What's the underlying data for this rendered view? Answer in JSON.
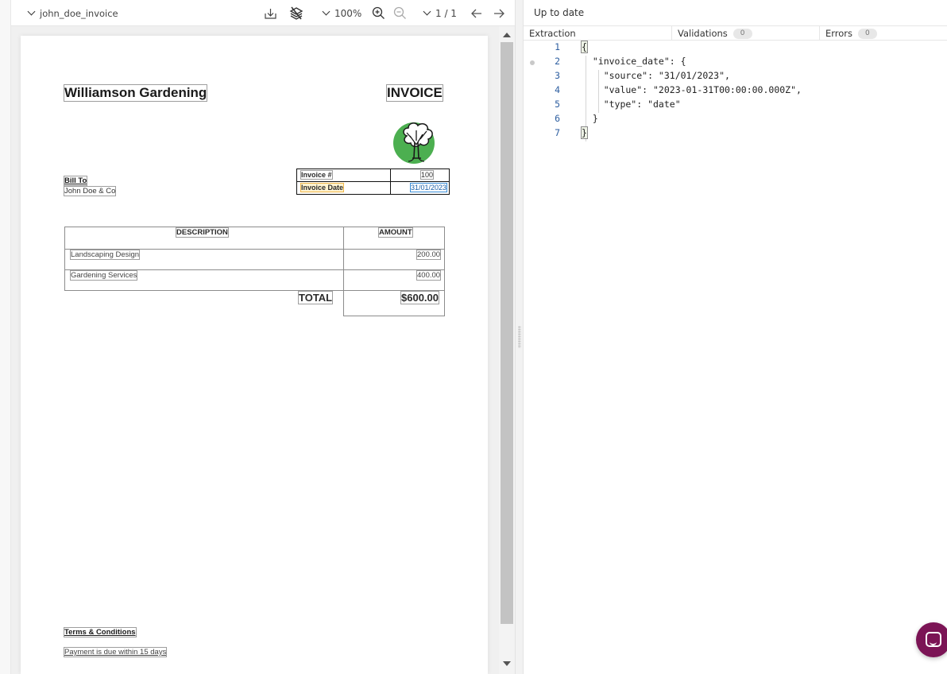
{
  "toolbar": {
    "document_name": "john_doe_invoice",
    "zoom": "100%",
    "page_indicator": "1 / 1",
    "icons": [
      "download-icon",
      "layers-off-icon",
      "zoom-in-icon",
      "zoom-out-icon",
      "arrow-left-icon",
      "arrow-right-icon"
    ]
  },
  "document": {
    "company": "Williamson Gardening",
    "heading": "INVOICE",
    "logo": "tree-logo",
    "bill_to_label": "Bill To",
    "bill_to_value": "John Doe & Co",
    "meta": [
      {
        "label": "Invoice #",
        "value": "100"
      },
      {
        "label": "Invoice Date",
        "value": "31/01/2023"
      }
    ],
    "items_headers": {
      "description": "DESCRIPTION",
      "amount": "AMOUNT"
    },
    "items": [
      {
        "description": "Landscaping Design",
        "amount": "200.00"
      },
      {
        "description": "Gardening Services",
        "amount": "400.00"
      }
    ],
    "total_label": "TOTAL",
    "total_amount": "$600.00",
    "terms_label": "Terms & Conditions",
    "terms_text": "Payment is due within 15 days"
  },
  "right_pane": {
    "status": "Up to date",
    "tabs": [
      {
        "label": "Extraction"
      },
      {
        "label": "Validations",
        "count": "0"
      },
      {
        "label": "Errors",
        "count": "0"
      }
    ],
    "code_lines": [
      {
        "n": "1",
        "text": "{"
      },
      {
        "n": "2",
        "text": "  \"invoice_date\": {"
      },
      {
        "n": "3",
        "text": "    \"source\": \"31/01/2023\","
      },
      {
        "n": "4",
        "text": "    \"value\": \"2023-01-31T00:00:00.000Z\","
      },
      {
        "n": "5",
        "text": "    \"type\": \"date\""
      },
      {
        "n": "6",
        "text": "  }"
      },
      {
        "n": "7",
        "text": "}"
      }
    ]
  },
  "colors": {
    "accent_launcher": "#7b1455",
    "highlight_label": "#f0b64a",
    "highlight_value": "#3b8fd9",
    "logo_green": "#4caf50"
  }
}
